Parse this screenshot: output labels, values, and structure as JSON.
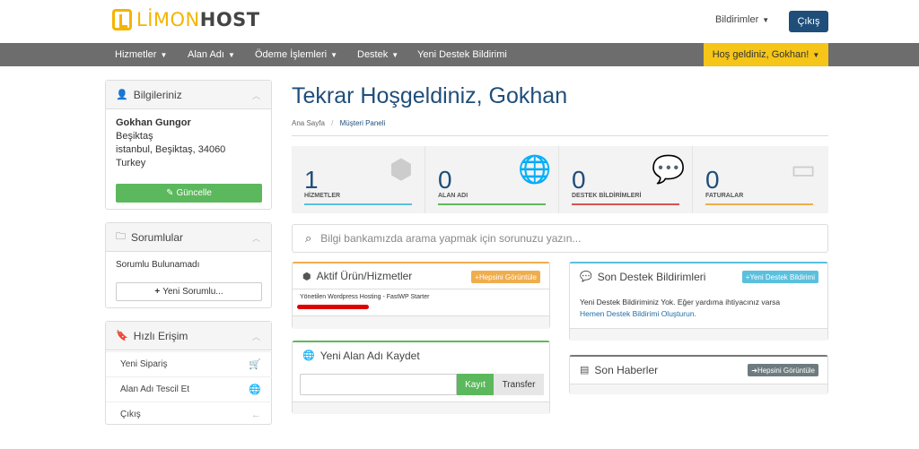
{
  "header": {
    "logo_part1": "LİMON",
    "logo_part2": "HOST",
    "notifications_label": "Bildirimler",
    "logout_label": "Çıkış"
  },
  "nav": {
    "items": [
      {
        "label": "Hizmetler",
        "dropdown": true
      },
      {
        "label": "Alan Adı",
        "dropdown": true
      },
      {
        "label": "Ödeme İşlemleri",
        "dropdown": true
      },
      {
        "label": "Destek",
        "dropdown": true
      },
      {
        "label": "Yeni Destek Bildirimi",
        "dropdown": false
      }
    ],
    "welcome": "Hoş geldiniz, Gokhan!"
  },
  "sidebar": {
    "info": {
      "title": "Bilgileriniz",
      "name": "Gokhan Gungor",
      "address1": "Beşiktaş",
      "address2": "istanbul, Beşiktaş, 34060",
      "country": "Turkey",
      "update_label": "Güncelle"
    },
    "contacts": {
      "title": "Sorumlular",
      "empty_text": "Sorumlu Bulunamadı",
      "new_label": "Yeni Sorumlu..."
    },
    "quick": {
      "title": "Hızlı Erişim",
      "items": [
        {
          "label": "Yeni Sipariş",
          "icon": "cart-icon"
        },
        {
          "label": "Alan Adı Tescil Et",
          "icon": "globe-icon"
        },
        {
          "label": "Çıkış",
          "icon": "arrow-left-icon"
        }
      ]
    }
  },
  "main": {
    "title": "Tekrar Hoşgeldiniz, Gokhan",
    "breadcrumb": [
      "Ana Sayfa",
      "Müşteri Paneli"
    ],
    "stats": [
      {
        "value": "1",
        "label": "HİZMETLER",
        "color": "#5bc0de",
        "icon": "cube-icon"
      },
      {
        "value": "0",
        "label": "ALAN ADI",
        "color": "#5cb85c",
        "icon": "globe-icon"
      },
      {
        "value": "0",
        "label": "DESTEK BİLDİRİMLERİ",
        "color": "#d9534f",
        "icon": "comments-icon"
      },
      {
        "value": "0",
        "label": "FATURALAR",
        "color": "#f0ad4e",
        "icon": "credit-card-icon"
      }
    ],
    "search_placeholder": "Bilgi bankamızda arama yapmak için sorunuzu yazın...",
    "products": {
      "title": "Aktif Ürün/Hizmetler",
      "view_all": "Hepsini Görüntüle",
      "item": "Yönetilen Wordpress Hosting - FastWP Starter"
    },
    "domain": {
      "title": "Yeni Alan Adı Kaydet",
      "register_label": "Kayıt",
      "transfer_label": "Transfer"
    },
    "tickets": {
      "title": "Son Destek Bildirimleri",
      "new_label": "Yeni Destek Bildirimi",
      "text": "Yeni Destek Bildiriminiz Yok. Eğer yardıma ihtiyacınız varsa",
      "link": "Hemen Destek Bildirimi Oluşturun."
    },
    "news": {
      "title": "Son Haberler",
      "view_all": "Hepsini Görüntüle"
    }
  }
}
